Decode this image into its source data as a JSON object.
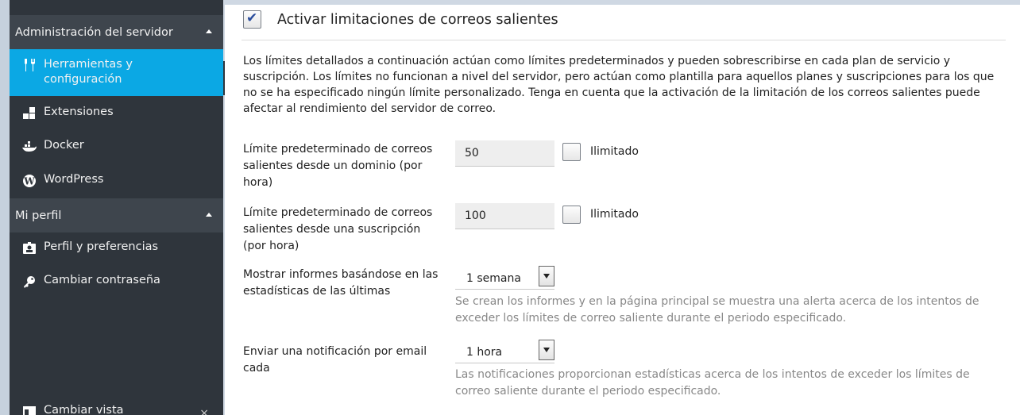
{
  "sidebar": {
    "sections": [
      {
        "title": "Administración del servidor",
        "items": [
          {
            "icon": "tools-icon",
            "label_line1": "Herramientas y",
            "label_line2": "configuración",
            "active": true
          },
          {
            "icon": "extensions-icon",
            "label": "Extensiones"
          },
          {
            "icon": "docker-icon",
            "label": "Docker"
          },
          {
            "icon": "wordpress-icon",
            "label": "WordPress"
          }
        ]
      },
      {
        "title": "Mi perfil",
        "items": [
          {
            "icon": "profile-card-icon",
            "label": "Perfil y preferencias"
          },
          {
            "icon": "key-icon",
            "label": "Cambiar contraseña"
          }
        ]
      }
    ],
    "footer": {
      "icon": "view-icon",
      "label": "Cambiar vista",
      "close": "×"
    }
  },
  "main": {
    "enable_limits": {
      "label": "Activar limitaciones de correos salientes",
      "checked": true
    },
    "intro": "Los límites detallados a continuación actúan como límites predeterminados y pueden sobrescribirse en cada plan de servicio y suscripción. Los límites no funcionan a nivel del servidor, pero actúan como plantilla para aquellos planes y suscripciones para los que no se ha especificado ningún límite personalizado. Tenga en cuenta que la activación de la limitación de los correos salientes puede afectar al rendimiento del servidor de correo.",
    "fields": {
      "domain_limit": {
        "label": "Límite predeterminado de correos salientes desde un dominio (por hora)",
        "value": "50",
        "unlimited_label": "Ilimitado",
        "unlimited": false
      },
      "subscription_limit": {
        "label": "Límite predeterminado de correos salientes desde una suscripción (por hora)",
        "value": "100",
        "unlimited_label": "Ilimitado",
        "unlimited": false
      },
      "reports_period": {
        "label": "Mostrar informes basándose en las estadísticas de las últimas",
        "selected": "1 semana",
        "hint": "Se crean los informes y en la página principal se muestra una alerta acerca de los intentos de exceder los límites de correo saliente durante el periodo especificado."
      },
      "notify_period": {
        "label": "Enviar una notificación por email cada",
        "selected": "1 hora",
        "hint": "Las notificaciones proporcionan estadísticas acerca de los intentos de exceder los límites de correo saliente durante el periodo especificado."
      }
    }
  },
  "colors": {
    "sidebar_bg": "#2f353c",
    "section_bg": "#3e454d",
    "active_bg": "#0ba8e4",
    "frame": "#cfd8e3",
    "hint_text": "#888888"
  }
}
